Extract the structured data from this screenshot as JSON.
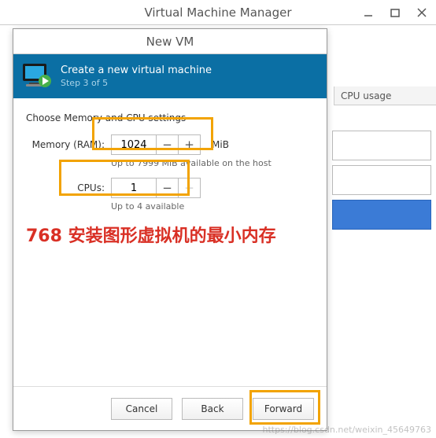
{
  "main_window": {
    "title": "Virtual Machine Manager",
    "cpu_usage_header": "CPU usage"
  },
  "dialog": {
    "title": "New VM",
    "banner_title": "Create a new virtual machine",
    "banner_step": "Step 3 of 5",
    "section_label": "Choose Memory and CPU settings",
    "memory": {
      "label": "Memory (RAM):",
      "value": "1024",
      "unit": "MiB",
      "hint": "Up to 7999 MiB available on the host"
    },
    "cpus": {
      "label": "CPUs:",
      "value": "1",
      "hint": "Up to 4 available"
    },
    "buttons": {
      "cancel": "Cancel",
      "back": "Back",
      "forward": "Forward"
    }
  },
  "annotation_text": "768 安装图形虚拟机的最小内存",
  "watermark": "https://blog.csdn.net/weixin_45649763"
}
